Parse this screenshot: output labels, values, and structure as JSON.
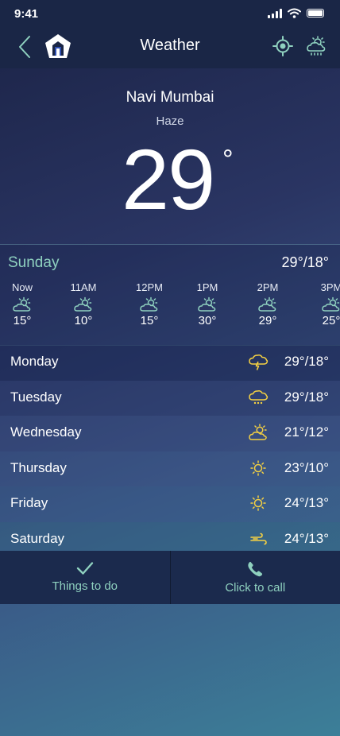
{
  "status_bar": {
    "time": "9:41"
  },
  "header": {
    "title": "Weather"
  },
  "current": {
    "city": "Navi Mumbai",
    "condition": "Haze",
    "temperature": "29",
    "degree_symbol": "°"
  },
  "today": {
    "day": "Sunday",
    "hi_lo": "29°/18°",
    "hours": [
      {
        "label": "Now",
        "temp": "15°",
        "icon": "partly-cloudy-icon"
      },
      {
        "label": "11AM",
        "temp": "10°",
        "icon": "partly-cloudy-icon"
      },
      {
        "label": "12PM",
        "temp": "15°",
        "icon": "partly-cloudy-icon"
      },
      {
        "label": "1PM",
        "temp": "30°",
        "icon": "partly-cloudy-icon"
      },
      {
        "label": "2PM",
        "temp": "29°",
        "icon": "partly-cloudy-icon"
      },
      {
        "label": "3PM",
        "temp": "25°",
        "icon": "partly-cloudy-icon"
      }
    ]
  },
  "forecast": [
    {
      "day": "Monday",
      "temp": "29°/18°",
      "icon": "thunderstorm-icon"
    },
    {
      "day": "Tuesday",
      "temp": "29°/18°",
      "icon": "rain-cloud-icon"
    },
    {
      "day": "Wednesday",
      "temp": "21°/12°",
      "icon": "partly-cloudy-icon"
    },
    {
      "day": "Thursday",
      "temp": "23°/10°",
      "icon": "sun-icon"
    },
    {
      "day": "Friday",
      "temp": "24°/13°",
      "icon": "sun-icon"
    },
    {
      "day": "Saturday",
      "temp": "24°/13°",
      "icon": "wind-icon"
    }
  ],
  "actions": {
    "things_to_do": "Things to do",
    "click_to_call": "Click to call"
  },
  "colors": {
    "accent": "#8fd1bf",
    "icon_yellow": "#f5d142",
    "bar_bg": "#1a2646"
  }
}
